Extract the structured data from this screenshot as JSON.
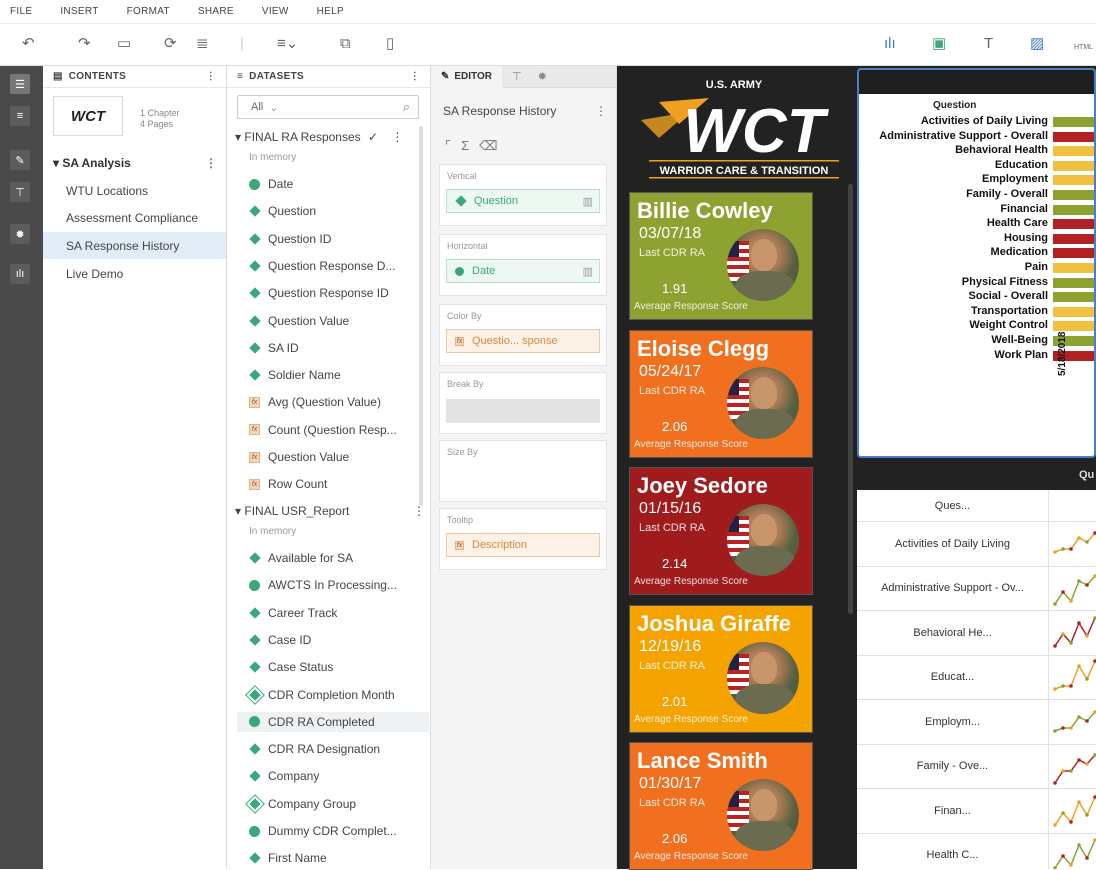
{
  "menu": [
    "FILE",
    "INSERT",
    "FORMAT",
    "SHARE",
    "VIEW",
    "HELP"
  ],
  "toolbar_right": {
    "html_label": "HTML"
  },
  "contents": {
    "header": "CONTENTS",
    "logo_text": "WCT",
    "chapter_count": "1 Chapter",
    "page_count": "4 Pages",
    "chapter_title": "SA Analysis",
    "pages": [
      "WTU Locations",
      "Assessment Compliance",
      "SA Response History",
      "Live Demo"
    ]
  },
  "datasets": {
    "header": "DATASETS",
    "filter_value": "All",
    "ds1": {
      "name": "FINAL RA Responses",
      "sub": "In memory"
    },
    "ds1_fields": [
      {
        "type": "clock",
        "label": "Date"
      },
      {
        "type": "dim",
        "label": "Question"
      },
      {
        "type": "dim",
        "label": "Question ID"
      },
      {
        "type": "dim",
        "label": "Question Response D..."
      },
      {
        "type": "dim",
        "label": "Question Response ID"
      },
      {
        "type": "dim",
        "label": "Question Value"
      },
      {
        "type": "dim",
        "label": "SA ID"
      },
      {
        "type": "dim",
        "label": "Soldier Name"
      },
      {
        "type": "fx",
        "label": "Avg (Question Value)"
      },
      {
        "type": "fx",
        "label": "Count (Question Resp..."
      },
      {
        "type": "fx",
        "label": "Question Value"
      },
      {
        "type": "fx",
        "label": "Row Count"
      }
    ],
    "ds2": {
      "name": "FINAL USR_Report",
      "sub": "In memory"
    },
    "ds2_fields": [
      {
        "type": "dim",
        "label": "Available for SA"
      },
      {
        "type": "clock",
        "label": "AWCTS In Processing..."
      },
      {
        "type": "dim",
        "label": "Career Track"
      },
      {
        "type": "dim",
        "label": "Case ID"
      },
      {
        "type": "dim",
        "label": "Case Status"
      },
      {
        "type": "hier",
        "label": "CDR Completion Month"
      },
      {
        "type": "clock",
        "label": "CDR RA Completed"
      },
      {
        "type": "dim",
        "label": "CDR RA Designation"
      },
      {
        "type": "dim",
        "label": "Company"
      },
      {
        "type": "hier",
        "label": "Company Group"
      },
      {
        "type": "clock",
        "label": "Dummy CDR Complet..."
      },
      {
        "type": "dim",
        "label": "First Name"
      }
    ]
  },
  "editor": {
    "tab": "EDITOR",
    "title": "SA Response History",
    "vertical": {
      "label": "Vertical",
      "value": "Question"
    },
    "horizontal": {
      "label": "Horizontal",
      "value": "Date"
    },
    "colorby": {
      "label": "Color By",
      "value": "Questio... sponse"
    },
    "breakby": {
      "label": "Break By"
    },
    "sizeby": {
      "label": "Size By"
    },
    "tooltip": {
      "label": "Tooltip",
      "value": "Description"
    }
  },
  "dashboard": {
    "logo_top": "U.S. ARMY",
    "logo_mid": "WCT",
    "logo_bottom": "WARRIOR CARE & TRANSITION",
    "cards": [
      {
        "name": "Billie Cowley",
        "date": "03/07/18",
        "label": "Last CDR RA",
        "score": "1.91",
        "score_label": "Average Response Score",
        "color": "#8ea232"
      },
      {
        "name": "Eloise Clegg",
        "date": "05/24/17",
        "label": "Last CDR RA",
        "score": "2.06",
        "score_label": "Average Response Score",
        "color": "#f07020"
      },
      {
        "name": "Joey Sedore",
        "date": "01/15/16",
        "label": "Last CDR RA",
        "score": "2.14",
        "score_label": "Average Response Score",
        "color": "#a01c1c"
      },
      {
        "name": "Joshua Giraffe",
        "date": "12/19/16",
        "label": "Last CDR RA",
        "score": "2.01",
        "score_label": "Average Response Score",
        "color": "#f5a300"
      },
      {
        "name": "Lance Smith",
        "date": "01/30/17",
        "label": "Last CDR RA",
        "score": "2.06",
        "score_label": "Average Response Score",
        "color": "#f07020"
      }
    ],
    "heatmap": {
      "column_header": "Question",
      "date": "5/18/2018",
      "rows": [
        {
          "label": "Activities of Daily Living",
          "color": "#8ea232"
        },
        {
          "label": "Administrative Support - Overall",
          "color": "#b22222"
        },
        {
          "label": "Behavioral Health",
          "color": "#f0c040"
        },
        {
          "label": "Education",
          "color": "#f0c040"
        },
        {
          "label": "Employment",
          "color": "#f0c040"
        },
        {
          "label": "Family - Overall",
          "color": "#8ea232"
        },
        {
          "label": "Financial",
          "color": "#8ea232"
        },
        {
          "label": "Health Care",
          "color": "#b22222"
        },
        {
          "label": "Housing",
          "color": "#b22222"
        },
        {
          "label": "Medication",
          "color": "#b22222"
        },
        {
          "label": "Pain",
          "color": "#f0c040"
        },
        {
          "label": "Physical Fitness",
          "color": "#8ea232"
        },
        {
          "label": "Social - Overall",
          "color": "#8ea232"
        },
        {
          "label": "Transportation",
          "color": "#f0c040"
        },
        {
          "label": "Weight Control",
          "color": "#f0c040"
        },
        {
          "label": "Well-Being",
          "color": "#8ea232"
        },
        {
          "label": "Work Plan",
          "color": "#b22222"
        }
      ]
    },
    "table": {
      "header": "Qu",
      "col1": "Ques...",
      "rows": [
        "Activities of Daily Living",
        "Administrative Support - Ov...",
        "Behavioral He...",
        "Educat...",
        "Employm...",
        "Family - Ove...",
        "Finan...",
        "Health C..."
      ]
    }
  }
}
